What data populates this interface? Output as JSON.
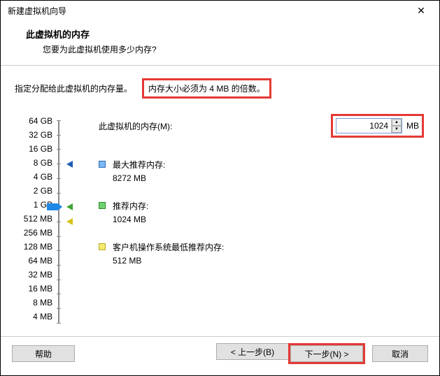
{
  "window": {
    "title": "新建虚拟机向导"
  },
  "header": {
    "title": "此虚拟机的内存",
    "subtitle": "您要为此虚拟机使用多少内存?"
  },
  "instruction": {
    "prefix": "指定分配给此虚拟机的内存量。",
    "highlighted": "内存大小必须为 4 MB 的倍数。"
  },
  "ruler_labels": [
    "64 GB",
    "32 GB",
    "16 GB",
    "8 GB",
    "4 GB",
    "2 GB",
    "1 GB",
    "512 MB",
    "256 MB",
    "128 MB",
    "64 MB",
    "32 MB",
    "16 MB",
    "8 MB",
    "4 MB"
  ],
  "memory_input": {
    "label": "此虚拟机的内存(M):",
    "value": "1024",
    "unit": "MB"
  },
  "recommendations": {
    "max": {
      "label": "最大推荐内存:",
      "value": "8272 MB"
    },
    "rec": {
      "label": "推荐内存:",
      "value": "1024 MB"
    },
    "min": {
      "label": "客户机操作系统最低推荐内存:",
      "value": "512 MB"
    }
  },
  "footer": {
    "help": "帮助",
    "back": "< 上一步(B)",
    "next": "下一步(N) >",
    "cancel": "取消"
  }
}
